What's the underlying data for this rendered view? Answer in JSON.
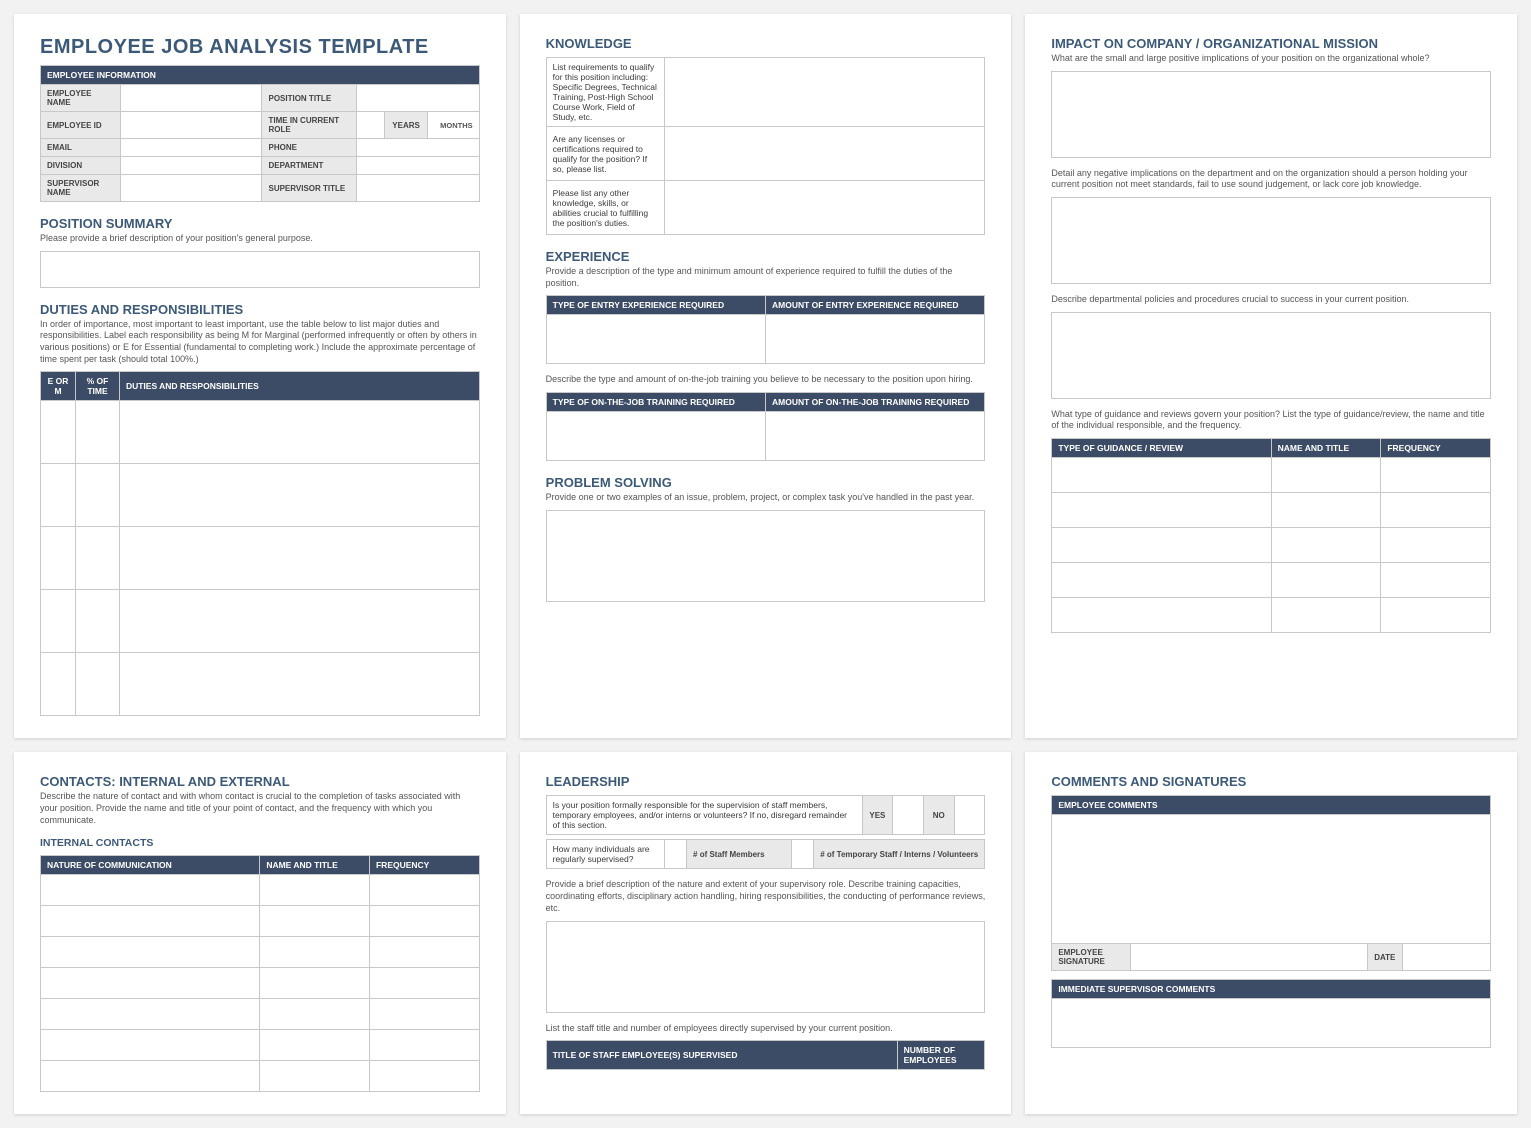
{
  "card1": {
    "title": "EMPLOYEE JOB ANALYSIS TEMPLATE",
    "empInfoHeader": "EMPLOYEE INFORMATION",
    "labels": {
      "name": "EMPLOYEE NAME",
      "posTitle": "POSITION TITLE",
      "id": "EMPLOYEE ID",
      "timeRole": "TIME IN CURRENT ROLE",
      "years": "YEARS",
      "months": "MONTHS",
      "email": "EMAIL",
      "phone": "PHONE",
      "division": "DIVISION",
      "dept": "DEPARTMENT",
      "supName": "SUPERVISOR NAME",
      "supTitle": "SUPERVISOR TITLE"
    },
    "posSummary": "POSITION SUMMARY",
    "posSummaryDesc": "Please provide a brief description of your position's general purpose.",
    "duties": "DUTIES AND RESPONSIBILITIES",
    "dutiesDesc": "In order of importance, most important to least important, use the table below to list major duties and responsibilities. Label each responsibility as being M for Marginal (performed infrequently or often by others in various positions) or E for Essential (fundamental to completing work.) Include the approximate percentage of time spent per task (should total 100%.)",
    "dutiesHead": {
      "a": "E or M",
      "b": "% of TIME",
      "c": "DUTIES AND RESPONSIBILITIES"
    }
  },
  "card2": {
    "knowledge": "KNOWLEDGE",
    "k1": "List requirements to qualify for this position including: Specific Degrees, Technical Training, Post-High School Course Work, Field of Study, etc.",
    "k2": "Are any licenses or certifications required to qualify for the position? If so, please list.",
    "k3": "Please list any other knowledge, skills, or abilities crucial to fulfilling the position's duties.",
    "experience": "EXPERIENCE",
    "expDesc": "Provide a description of the type and minimum amount of experience required to fulfill the duties of the position.",
    "expHead": {
      "a": "TYPE OF ENTRY EXPERIENCE REQUIRED",
      "b": "AMOUNT OF ENTRY EXPERIENCE REQUIRED"
    },
    "expDesc2": "Describe the type and amount of on-the-job training you believe to be necessary to the position upon hiring.",
    "expHead2": {
      "a": "TYPE OF ON-THE-JOB TRAINING REQUIRED",
      "b": "AMOUNT OF ON-THE-JOB TRAINING REQUIRED"
    },
    "problem": "PROBLEM SOLVING",
    "problemDesc": "Provide one or two examples of an issue, problem, project, or complex task you've handled in the past year."
  },
  "card3": {
    "impact": "IMPACT ON COMPANY / ORGANIZATIONAL MISSION",
    "q1": "What are the small and large positive implications of your position on the organizational whole?",
    "q2": "Detail any negative implications on the department and on the organization should a person holding your current position not meet standards, fail to use sound judgement, or lack core job knowledge.",
    "q3": "Describe departmental policies and procedures crucial to success in your current position.",
    "q4": "What type of guidance and reviews govern your position?  List the type of guidance/review, the name and title of the individual responsible, and the frequency.",
    "gHead": {
      "a": "TYPE OF GUIDANCE / REVIEW",
      "b": "NAME AND TITLE",
      "c": "FREQUENCY"
    }
  },
  "card4": {
    "title": "CONTACTS: INTERNAL AND EXTERNAL",
    "desc": "Describe the nature of contact and with whom contact is crucial to the completion of tasks associated with your position. Provide the name and title of your point of contact, and the frequency with which you communicate.",
    "sub": "INTERNAL CONTACTS",
    "head": {
      "a": "NATURE OF COMMUNICATION",
      "b": "NAME AND TITLE",
      "c": "FREQUENCY"
    }
  },
  "card5": {
    "title": "LEADERSHIP",
    "q1": "Is your position formally responsible for the supervision of staff members, temporary employees, and/or interns or volunteers? If no, disregard remainder of this section.",
    "yes": "YES",
    "no": "NO",
    "q2": "How many individuals are regularly supervised?",
    "staff": "# of Staff Members",
    "temp": "# of Temporary Staff / Interns / Volunteers",
    "desc2": "Provide a brief description of the nature and extent of your supervisory role.  Describe training capacities, coordinating efforts, disciplinary action handling, hiring responsibilities, the conducting of performance reviews, etc.",
    "desc3": "List the staff title and number of employees directly supervised by your current position.",
    "head": {
      "a": "TITLE OF STAFF EMPLOYEE(S) SUPERVISED",
      "b": "NUMBER OF EMPLOYEES"
    }
  },
  "card6": {
    "title": "COMMENTS AND SIGNATURES",
    "h1": "EMPLOYEE COMMENTS",
    "sig": "EMPLOYEE SIGNATURE",
    "date": "DATE",
    "h2": "IMMEDIATE SUPERVISOR COMMENTS"
  }
}
